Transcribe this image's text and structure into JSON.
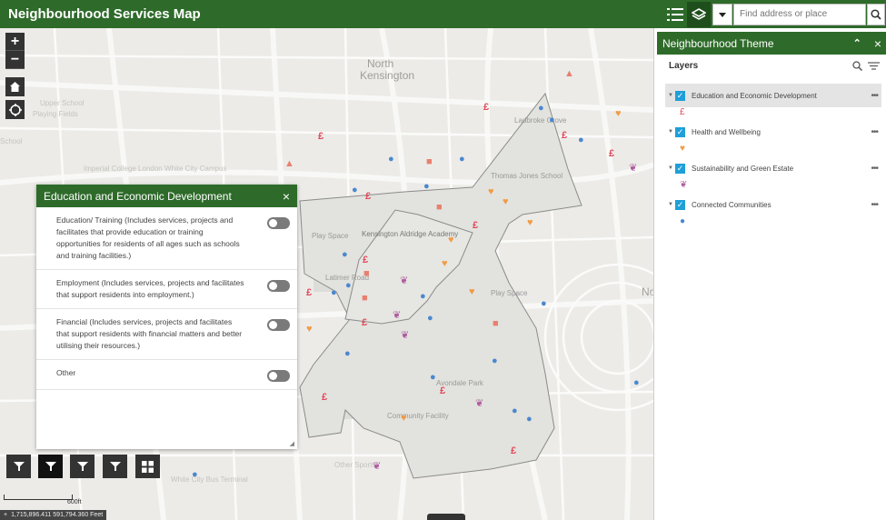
{
  "app": {
    "title": "Neighbourhood Services Map",
    "search_placeholder": "Find address or place",
    "list_icon": "list-icon",
    "layers_icon": "layers-icon",
    "search_icon": "search-icon",
    "header_color": "#2e6b2a"
  },
  "map": {
    "labels": {
      "north_kensington_1": "North",
      "north_kensington_2": "Kensington",
      "upper_school": "Upper School",
      "playing_fields": "Playing Fields",
      "school": "School",
      "campus": "Imperial College London White City Campus",
      "academy": "Kensington Aldridge Academy",
      "ladbroke_grove": "Ladbroke Grove",
      "thomas_jones": "Thomas Jones School",
      "play_space_1": "Play Space",
      "play_space_2": "Play Space",
      "avondale_park": "Avondale Park",
      "community_facility": "Community Facility",
      "sports": "Other Sports",
      "terminal": "White City Bus Terminal",
      "latimer": "Latimer Road",
      "no": "No"
    },
    "scale_text": "600ft",
    "coords": "1,715,896.411 591,794.360 Feet"
  },
  "popup": {
    "title": "Education and Economic Development",
    "close": "×",
    "rows": [
      {
        "text": "Education/ Training (Includes services, projects and facilitates that provide education or training opportunities for residents of all ages such as schools and training facilities.)",
        "on": false
      },
      {
        "text": "Employment (Includes services, projects and facilitates that support residents into employment.)",
        "on": false
      },
      {
        "text": "Financial (Includes services, projects and facilitates that support residents with financial matters and better utilising their resources.)",
        "on": false
      },
      {
        "text": "Other",
        "on": false
      }
    ]
  },
  "panel": {
    "title": "Neighbourhood Theme",
    "collapse": "⌃",
    "close": "×",
    "layers_label": "Layers",
    "layers": [
      {
        "name": "Education and Economic Development",
        "symbol": "£",
        "symbol_color": "#e34a5b",
        "checked": true
      },
      {
        "name": "Health and Wellbeing",
        "symbol": "♥",
        "symbol_color": "#f29b45",
        "checked": true
      },
      {
        "name": "Sustainability and Green Estate",
        "symbol": "❦",
        "symbol_color": "#b05c9e",
        "checked": true
      },
      {
        "name": "Connected Communities",
        "symbol": "●",
        "symbol_color": "#4a88cf",
        "checked": true
      }
    ]
  }
}
